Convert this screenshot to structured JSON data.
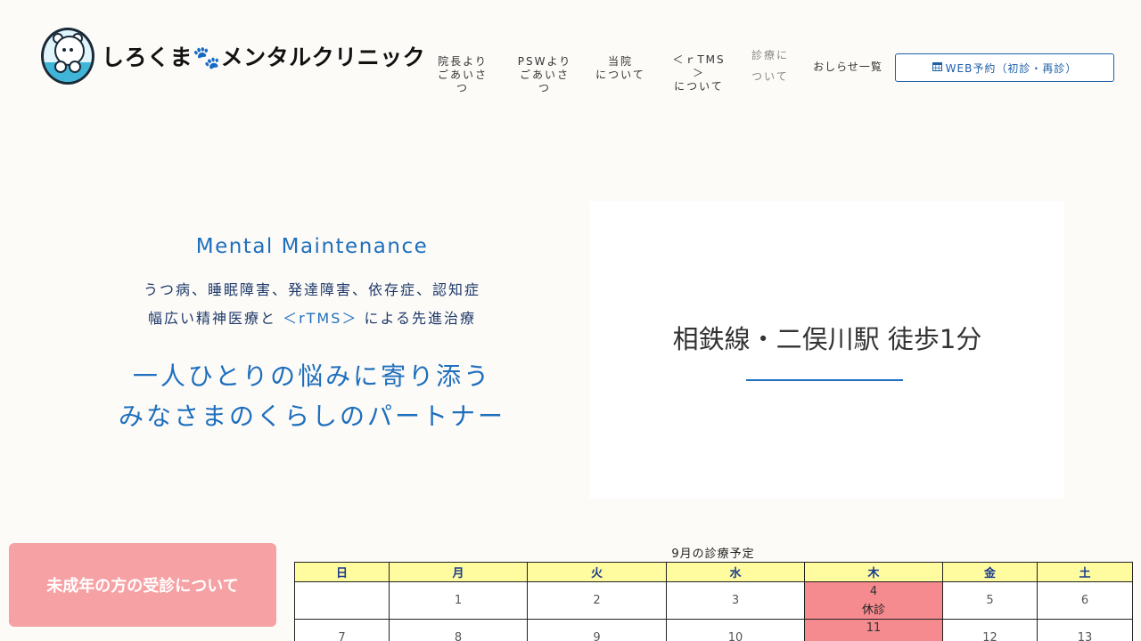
{
  "header": {
    "logo_text": "しろくま🐾メンタルクリニック",
    "nav": [
      {
        "line1": "院長より",
        "line2": "ごあいさつ"
      },
      {
        "line1": "PSWより",
        "line2": "ごあいさつ"
      },
      {
        "line1": "当院",
        "line2": "について"
      },
      {
        "line1": "＜ｒTMS＞",
        "line2": "について"
      },
      {
        "line1": "診療に",
        "line2": "ついて"
      },
      {
        "line1": "おしらせ一覧"
      }
    ],
    "web_button": {
      "icon": "calendar-icon",
      "label": "WEB予約（初診・再診）"
    }
  },
  "hero": {
    "english": "Mental Maintenance",
    "sub_line1": "うつ病、睡眠障害、発達障害、依存症、認知症",
    "sub_line2_a": "幅広い精神医療と",
    "sub_line2_rtms": "＜rTMS＞",
    "sub_line2_b": "による先進治療",
    "main_line1": "一人ひとりの悩みに寄り添う",
    "main_line2": "みなさまのくらしのパートナー",
    "card_text": "相鉄線・二俣川駅 徒歩1分"
  },
  "minor_button": {
    "label": "未成年の方の受診について"
  },
  "calendar": {
    "title": "9月の診療予定",
    "days": [
      "日",
      "月",
      "火",
      "水",
      "木",
      "金",
      "土"
    ],
    "rows": [
      [
        "",
        "1",
        "2",
        "3",
        "4",
        "5",
        "6"
      ],
      [
        "7",
        "8",
        "9",
        "10",
        "11",
        "12",
        "13"
      ]
    ],
    "holiday_label": "休診",
    "colors": {
      "header_bg": "#fffca0",
      "holiday_bg": "#f58b8f",
      "accent": "#1e6fbd"
    }
  }
}
